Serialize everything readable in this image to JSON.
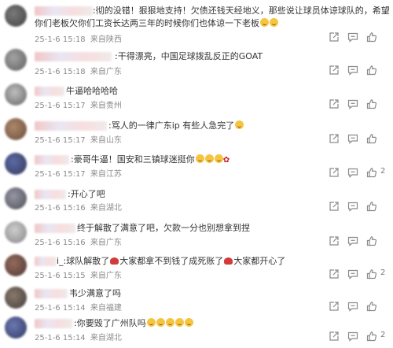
{
  "comments": [
    {
      "text_line1": ":彻的没错！狠狠地支持！欠债还钱天经地义，那些说让球员体谅球队的，希望",
      "text_line2": "你们老板欠你们工资长达两三年的时候你们也体谅一下老板",
      "emoji": [
        "laugh-cry-emoji",
        "laugh-cry-emoji"
      ],
      "date": "25-1-6 15:18",
      "location": "来自陕西",
      "likes": ""
    },
    {
      "text": ":干得漂亮，中国足球拨乱反正的GOAT",
      "date": "25-1-6 15:18",
      "location": "来自广东",
      "likes": ""
    },
    {
      "text": "牛逼哈哈哈哈",
      "date": "25-1-6 15:17",
      "location": "来自贵州",
      "likes": ""
    },
    {
      "text": ":骂人的一律广东ip 有些人急完了",
      "emoji": [
        "laugh-cry-emoji"
      ],
      "date": "25-1-6 15:17",
      "location": "来自山东",
      "likes": ""
    },
    {
      "text": ":豪哥牛逼！国安和三镇球迷挺你",
      "emoji": [
        "grin-emoji",
        "grin-emoji",
        "grin-emoji",
        "rose-emoji"
      ],
      "date": "25-1-6 15:17",
      "location": "来自江苏",
      "likes": "2"
    },
    {
      "text": ":开心了吧",
      "date": "25-1-6 15:16",
      "location": "来自湖北",
      "likes": ""
    },
    {
      "text": "终于解散了满意了吧，欠款一分也别想拿到捏",
      "date": "25-1-6 15:16",
      "location": "来自广东",
      "likes": ""
    },
    {
      "text_part1": "i_:球队解散了",
      "text_part2": "大家都拿不到钱了成死账了",
      "text_part3": "大家都开心了",
      "date": "25-1-6 15:15",
      "location": "来自广东",
      "likes": "2"
    },
    {
      "text": "韦少满意了吗",
      "date": "25-1-6 15:14",
      "location": "来自福建",
      "likes": ""
    },
    {
      "text": ":你要毁了广州队吗",
      "emoji": [
        "laugh-cry-emoji",
        "laugh-cry-emoji",
        "laugh-cry-emoji",
        "laugh-cry-emoji",
        "laugh-cry-emoji"
      ],
      "date": "25-1-6 15:14",
      "location": "来自湖北",
      "likes": "2"
    }
  ],
  "icons": {
    "share": "share-icon",
    "comment": "comment-icon",
    "like": "thumbs-up-icon"
  },
  "colors": {
    "text": "#333333",
    "meta": "#8b8b8b",
    "icon": "#8a8a8a"
  }
}
